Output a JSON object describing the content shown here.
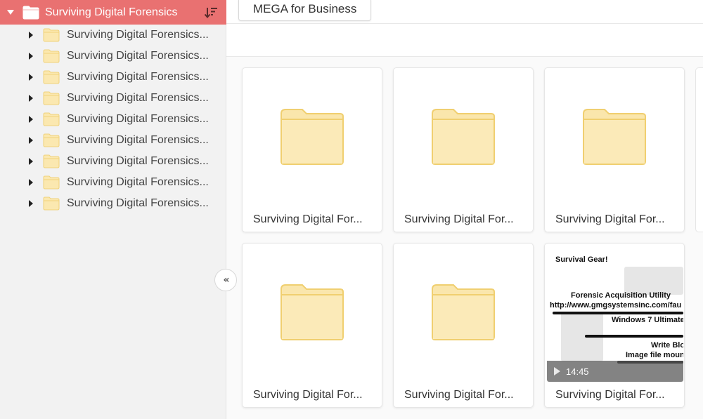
{
  "sidebar": {
    "root": {
      "label": "Surviving Digital Forensics",
      "icon": "folder-icon"
    },
    "sort_icon": "sort-descending-icon",
    "items": [
      {
        "label": "Surviving Digital Forensics..."
      },
      {
        "label": "Surviving Digital Forensics..."
      },
      {
        "label": "Surviving Digital Forensics..."
      },
      {
        "label": "Surviving Digital Forensics..."
      },
      {
        "label": "Surviving Digital Forensics..."
      },
      {
        "label": "Surviving Digital Forensics..."
      },
      {
        "label": "Surviving Digital Forensics..."
      },
      {
        "label": "Surviving Digital Forensics..."
      },
      {
        "label": "Surviving Digital Forensics..."
      }
    ],
    "collapse_label": "«"
  },
  "header": {
    "mega_button": "MEGA for Business"
  },
  "grid": {
    "cards": [
      {
        "name": "Surviving Digital For...",
        "type": "folder"
      },
      {
        "name": "Surviving Digital For...",
        "type": "folder"
      },
      {
        "name": "Surviving Digital For...",
        "type": "folder"
      },
      {
        "name": "Surviving Digital For...",
        "type": "folder"
      },
      {
        "name": "Surviving Digital For...",
        "type": "folder"
      },
      {
        "name": "Surviving Digital For...",
        "type": "video"
      }
    ],
    "video": {
      "duration": "14:45",
      "slide_lines": [
        "Survival Gear!",
        "Forensic Acquisition Utility",
        "http://www.gmgsystemsinc.com/fau",
        "Windows 7 Ultimate",
        "Write Blo",
        "Image file moun"
      ]
    }
  },
  "colors": {
    "accent": "#e97171",
    "folder_fill": "#fbe8b0",
    "folder_stroke": "#f0d27a"
  }
}
